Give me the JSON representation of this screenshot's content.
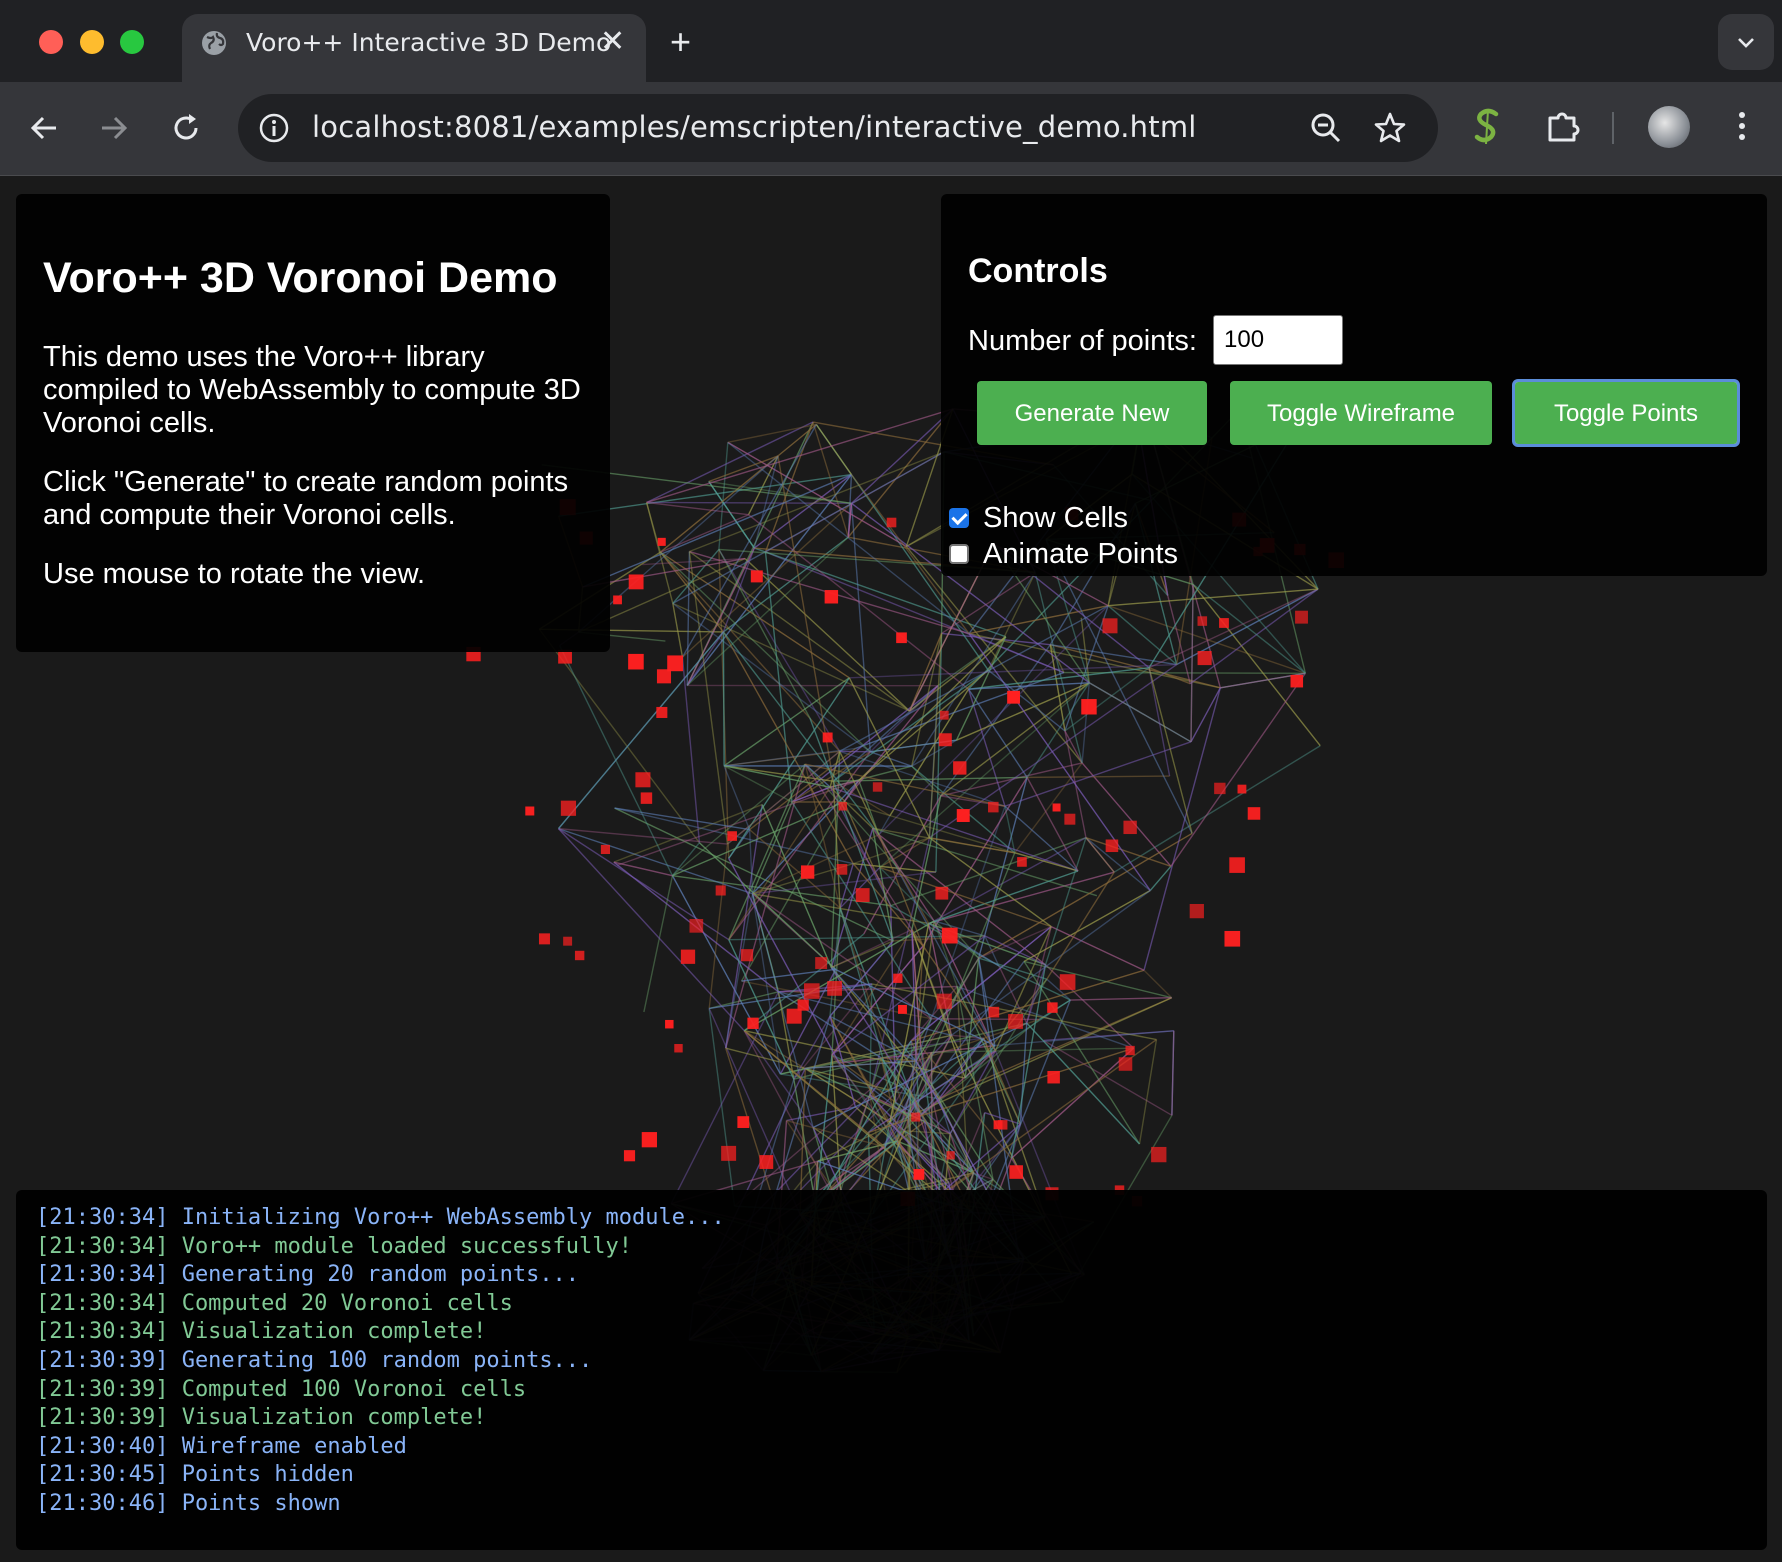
{
  "browser": {
    "tab_title": "Voro++ Interactive 3D Demo",
    "url": "localhost:8081/examples/emscripten/interactive_demo.html",
    "icons": [
      "globe-icon",
      "close-icon",
      "plus-icon",
      "back-icon",
      "forward-icon",
      "reload-icon",
      "info-icon",
      "zoom-icon",
      "star-icon",
      "extension-s-icon",
      "puzzle-icon",
      "avatar",
      "more-icon",
      "chevron-down-icon"
    ]
  },
  "info": {
    "title": "Voro++ 3D Voronoi Demo",
    "paragraphs": [
      "This demo uses the Voro++ library compiled to WebAssembly to compute 3D Voronoi cells.",
      "Click \"Generate\" to create random points and compute their Voronoi cells.",
      "Use mouse to rotate the view."
    ]
  },
  "controls": {
    "title": "Controls",
    "num_points_label": "Number of points:",
    "num_points_value": "100",
    "generate_label": "Generate New",
    "wireframe_label": "Toggle Wireframe",
    "points_label": "Toggle Points",
    "show_cells_label": "Show Cells",
    "show_cells_checked": true,
    "animate_points_label": "Animate Points",
    "animate_points_checked": false,
    "button_color": "#4caf50"
  },
  "console": {
    "lines": [
      {
        "time": "[21:30:34]",
        "msg": "Initializing Voro++ WebAssembly module...",
        "level": "info"
      },
      {
        "time": "[21:30:34]",
        "msg": "Voro++ module loaded successfully!",
        "level": "success"
      },
      {
        "time": "[21:30:34]",
        "msg": "Generating 20 random points...",
        "level": "info"
      },
      {
        "time": "[21:30:34]",
        "msg": "Computed 20 Voronoi cells",
        "level": "success"
      },
      {
        "time": "[21:30:34]",
        "msg": "Visualization complete!",
        "level": "success"
      },
      {
        "time": "[21:30:39]",
        "msg": "Generating 100 random points...",
        "level": "info"
      },
      {
        "time": "[21:30:39]",
        "msg": "Computed 100 Voronoi cells",
        "level": "success"
      },
      {
        "time": "[21:30:39]",
        "msg": "Visualization complete!",
        "level": "success"
      },
      {
        "time": "[21:30:40]",
        "msg": "Wireframe enabled",
        "level": "info"
      },
      {
        "time": "[21:30:45]",
        "msg": "Points hidden",
        "level": "info"
      },
      {
        "time": "[21:30:46]",
        "msg": "Points shown",
        "level": "info"
      }
    ],
    "info_color": "#8ab4f8",
    "success_color": "#81c995"
  },
  "scene": {
    "point_color": "#ff2020",
    "edge_colors": [
      "#7a5bb5",
      "#4f9a8f",
      "#9a9a4a",
      "#5e7fb8",
      "#a35a8a",
      "#6aa36a",
      "#8a6a3a"
    ]
  }
}
